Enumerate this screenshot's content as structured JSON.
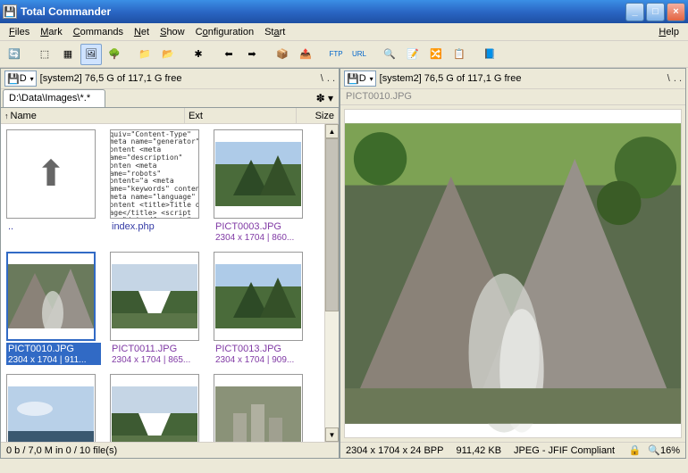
{
  "window": {
    "title": "Total Commander"
  },
  "menu": {
    "items": [
      "Files",
      "Mark",
      "Commands",
      "Net",
      "Show",
      "Configuration",
      "Start"
    ],
    "help": "Help"
  },
  "drive": {
    "label": "D",
    "freespace": "[system2]  76,5 G of 117,1 G free"
  },
  "left": {
    "tab": "D:\\Data\\Images\\*.*",
    "headers": {
      "name": "Name",
      "ext": "Ext",
      "size": "Size"
    },
    "thumbs": [
      {
        "name": "..",
        "type": "up"
      },
      {
        "name": "index.php",
        "type": "code",
        "dims": ""
      },
      {
        "name": "PICT0003.JPG",
        "dims": "2304 x 1704 | 860...",
        "visited": true
      },
      {
        "name": "PICT0010.JPG",
        "dims": "2304 x 1704 | 911...",
        "selected": true
      },
      {
        "name": "PICT0011.JPG",
        "dims": "2304 x 1704 | 865...",
        "visited": true
      },
      {
        "name": "PICT0013.JPG",
        "dims": "2304 x 1704 | 909...",
        "visited": true
      },
      {
        "name": "",
        "dims": ""
      },
      {
        "name": "",
        "dims": ""
      },
      {
        "name": "",
        "dims": ""
      }
    ],
    "status": "0 b / 7,0 M in 0 / 10 file(s)"
  },
  "right": {
    "preview_name": "PICT0010.JPG",
    "status": {
      "dims": "2304 x 1704 x 24 BPP",
      "size": "911,42 KB",
      "format": "JPEG - JFIF Compliant",
      "zoom": "16%"
    }
  },
  "code_preview": "<!DOCTYPE HTML PUBLIC \"-//W\n<html><head>\n<meta http-equiv=\"Content-Type\"\n<meta name=\"generator\" content\n<meta name=\"description\" conten\n<meta name=\"robots\" content=\"a\n<meta name=\"keywords\" content\n<meta name=\"language\" content\n<title>Title of Page</title>\n\n<script src=\"/_inc/funcs.js\" type\n<style type=\"text/css\">@import"
}
